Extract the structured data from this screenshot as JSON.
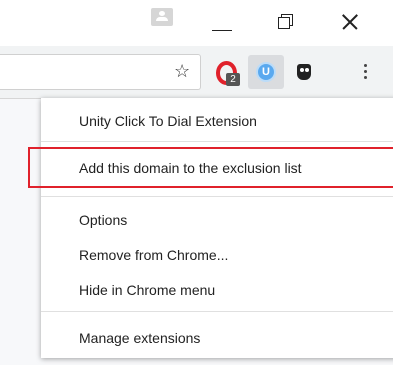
{
  "window": {
    "profile_icon": "person-icon",
    "minimize_icon": "minimize-icon",
    "restore_icon": "restore-icon",
    "close_icon": "close-icon"
  },
  "toolbar": {
    "bookmark_icon": "star-icon",
    "extensions": [
      {
        "name": "opera-extension-icon",
        "badge": "2",
        "color": "#e0212b"
      },
      {
        "name": "unity-extension-icon",
        "letter": "U",
        "color": "#5aa9ef"
      },
      {
        "name": "owl-extension-icon",
        "color": "#222222"
      }
    ],
    "menu_icon": "kebab-menu-icon"
  },
  "context_menu": {
    "title": "Unity Click To Dial Extension",
    "items": [
      {
        "label": "Add this domain to the exclusion list",
        "highlighted": true
      },
      {
        "label": "Options"
      },
      {
        "label": "Remove from Chrome..."
      },
      {
        "label": "Hide in Chrome menu"
      },
      {
        "label": "Manage extensions"
      }
    ],
    "highlight_color": "#e0212b"
  }
}
